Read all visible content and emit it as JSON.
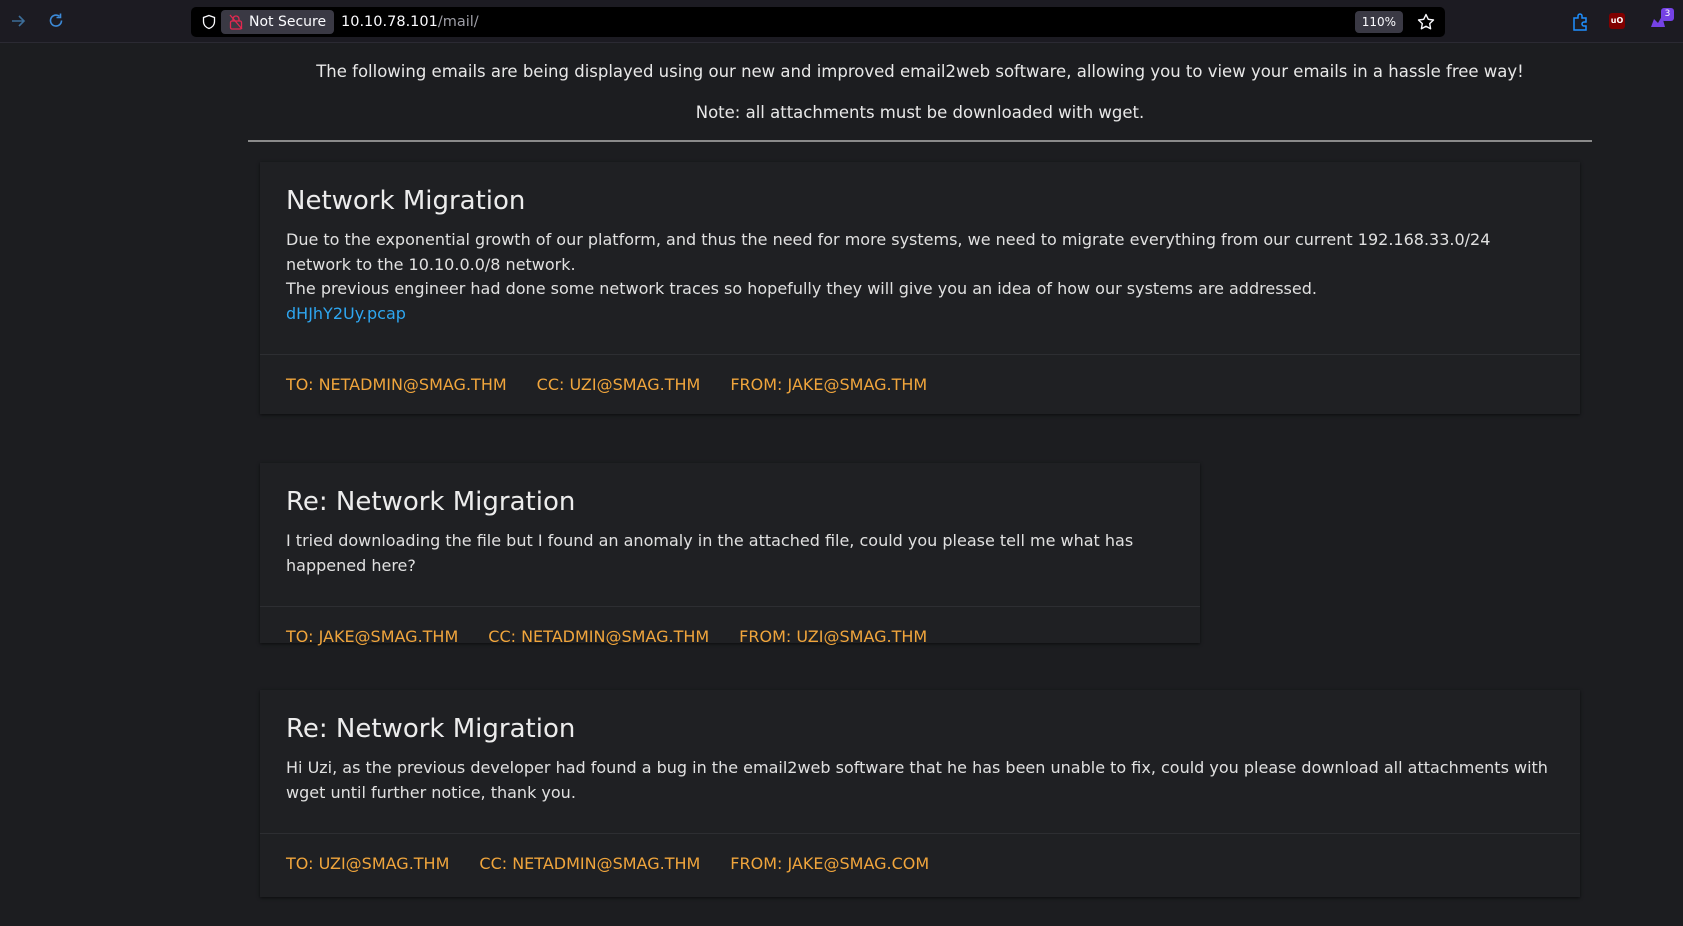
{
  "browser": {
    "security_label": "Not Secure",
    "url_host": "10.10.78.101",
    "url_path": "/mail/",
    "zoom": "110%",
    "extension_badge_count": "3"
  },
  "page": {
    "intro": "The following emails are being displayed using our new and improved email2web software, allowing you to view your emails in a hassle free way!",
    "note": "Note: all attachments must be downloaded with wget."
  },
  "emails": [
    {
      "subject": "Network Migration",
      "body_lines": [
        "Due to the exponential growth of our platform, and thus the need for more systems, we need to migrate everything from our current 192.168.33.0/24 network to the 10.10.0.0/8 network.",
        "The previous engineer had done some network traces so hopefully they will give you an idea of how our systems are addressed."
      ],
      "attachment": "dHJhY2Uy.pcap",
      "to": "TO: NETADMIN@SMAG.THM",
      "cc": "CC: UZI@SMAG.THM",
      "from": "FROM: JAKE@SMAG.THM"
    },
    {
      "subject": "Re: Network Migration",
      "body_lines": [
        "I tried downloading the file but I found an anomaly in the attached file, could you please tell me what has happened here?"
      ],
      "to": "TO: JAKE@SMAG.THM",
      "cc": "CC: NETADMIN@SMAG.THM",
      "from": "FROM: UZI@SMAG.THM"
    },
    {
      "subject": "Re: Network Migration",
      "body_lines": [
        "Hi Uzi, as the previous developer had found a bug in the email2web software that he has been unable to fix, could you please download all attachments with wget until further notice, thank you."
      ],
      "to": "TO: UZI@SMAG.THM",
      "cc": "CC: NETADMIN@SMAG.THM",
      "from": "FROM: JAKE@SMAG.COM"
    }
  ],
  "colors": {
    "page_bg": "#1c1d20",
    "card_bg": "#1f2023",
    "accent_orange": "#f0a53c",
    "link_blue": "#2ea6f0"
  },
  "icons": [
    "forward-icon",
    "reload-icon",
    "shield-icon",
    "lock-icon",
    "star-icon",
    "extension-icon",
    "ublock-icon",
    "extension-badge-icon"
  ]
}
